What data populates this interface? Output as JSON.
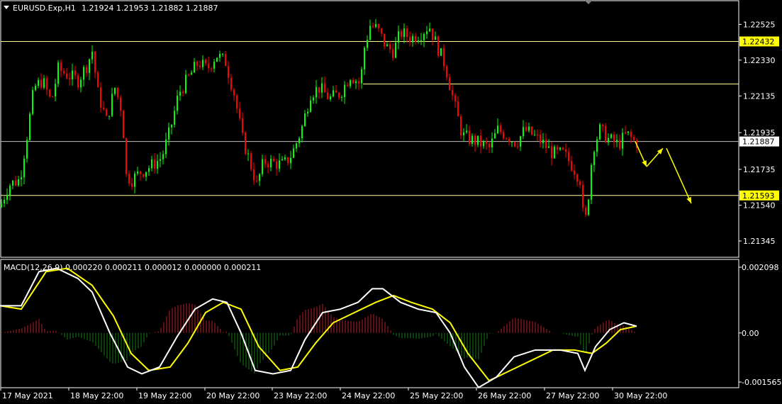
{
  "header": {
    "symbol": "EURUSD.Exp,H1",
    "ohlc": "1.21924 1.21953 1.21882 1.21887"
  },
  "macd_header": {
    "title": "MACD(12,26,9)",
    "values": "0.000220 0.000211 0.000012 0.000000 0.000211"
  },
  "price_axis": {
    "ticks": [
      "1.22525",
      "1.22330",
      "1.22135",
      "1.21935",
      "1.21735",
      "1.21540",
      "1.21345"
    ],
    "highlight_labels": [
      {
        "text": "1.22432",
        "color": "#ffff00"
      },
      {
        "text": "1.21887",
        "color": "#ffffff"
      },
      {
        "text": "1.21593",
        "color": "#ffff00"
      }
    ]
  },
  "macd_axis": {
    "ticks": [
      "0.002098",
      "0.00",
      "-0.001565"
    ]
  },
  "time_axis": {
    "labels": [
      "17 May 2021",
      "18 May 22:00",
      "19 May 22:00",
      "20 May 22:00",
      "23 May 22:00",
      "24 May 22:00",
      "25 May 22:00",
      "26 May 22:00",
      "27 May 22:00",
      "30 May 22:00"
    ]
  },
  "colors": {
    "background": "#000000",
    "bull": "#00ff00",
    "bear": "#ff0000",
    "level_line": "#ffff99",
    "signal": "#ffff00",
    "macd_line": "#ffffff",
    "hist_pos": "#b22222",
    "hist_neg": "#1a7a1a"
  },
  "chart_data": {
    "type": "candlestick",
    "symbol": "EURUSD",
    "timeframe": "H1",
    "ylim": [
      1.2126,
      1.2265
    ],
    "horizontal_levels": [
      1.22432,
      1.222,
      1.21887,
      1.21593
    ],
    "price_path": [
      [
        0,
        1.2153
      ],
      [
        12,
        1.2165
      ],
      [
        28,
        1.2168
      ],
      [
        38,
        1.2192
      ],
      [
        48,
        1.2218
      ],
      [
        60,
        1.2222
      ],
      [
        72,
        1.221
      ],
      [
        82,
        1.2228
      ],
      [
        95,
        1.2225
      ],
      [
        110,
        1.2222
      ],
      [
        122,
        1.223
      ],
      [
        130,
        1.2238
      ],
      [
        138,
        1.2215
      ],
      [
        150,
        1.22
      ],
      [
        162,
        1.2218
      ],
      [
        172,
        1.2205
      ],
      [
        178,
        1.217
      ],
      [
        186,
        1.2168
      ],
      [
        198,
        1.2172
      ],
      [
        212,
        1.2175
      ],
      [
        228,
        1.218
      ],
      [
        240,
        1.2195
      ],
      [
        252,
        1.2215
      ],
      [
        265,
        1.2223
      ],
      [
        280,
        1.2232
      ],
      [
        292,
        1.2228
      ],
      [
        305,
        1.2236
      ],
      [
        318,
        1.2232
      ],
      [
        330,
        1.2215
      ],
      [
        342,
        1.219
      ],
      [
        352,
        1.2178
      ],
      [
        362,
        1.2165
      ],
      [
        372,
        1.2178
      ],
      [
        386,
        1.2177
      ],
      [
        400,
        1.2176
      ],
      [
        412,
        1.2182
      ],
      [
        425,
        1.2195
      ],
      [
        438,
        1.2215
      ],
      [
        450,
        1.2218
      ],
      [
        465,
        1.2212
      ],
      [
        480,
        1.2215
      ],
      [
        494,
        1.2225
      ],
      [
        508,
        1.222
      ],
      [
        514,
        1.224
      ],
      [
        522,
        1.2252
      ],
      [
        532,
        1.225
      ],
      [
        545,
        1.224
      ],
      [
        555,
        1.2238
      ],
      [
        565,
        1.2248
      ],
      [
        580,
        1.2245
      ],
      [
        595,
        1.2248
      ],
      [
        605,
        1.2252
      ],
      [
        615,
        1.2242
      ],
      [
        628,
        1.223
      ],
      [
        640,
        1.221
      ],
      [
        652,
        1.2192
      ],
      [
        662,
        1.219
      ],
      [
        676,
        1.2188
      ],
      [
        690,
        1.2185
      ],
      [
        702,
        1.2195
      ],
      [
        715,
        1.2192
      ],
      [
        728,
        1.2188
      ],
      [
        740,
        1.2195
      ],
      [
        752,
        1.2192
      ],
      [
        765,
        1.2188
      ],
      [
        780,
        1.2182
      ],
      [
        795,
        1.2182
      ],
      [
        808,
        1.2175
      ],
      [
        818,
        1.2168
      ],
      [
        824,
        1.214
      ],
      [
        830,
        1.216
      ],
      [
        836,
        1.2185
      ],
      [
        846,
        1.2195
      ],
      [
        858,
        1.219
      ],
      [
        872,
        1.2187
      ],
      [
        884,
        1.2193
      ],
      [
        896,
        1.2188
      ]
    ],
    "forecast_arrows": [
      {
        "from": [
          896,
          1.21887
        ],
        "to": [
          912,
          1.2175
        ]
      },
      {
        "from": [
          912,
          1.2175
        ],
        "to": [
          935,
          1.2185
        ]
      },
      {
        "from": [
          940,
          1.2185
        ],
        "to": [
          975,
          1.2155
        ]
      }
    ],
    "macd": {
      "ylim": [
        -0.001565,
        0.002098
      ],
      "macd_line": [
        [
          0,
          0.0008
        ],
        [
          30,
          0.0008
        ],
        [
          55,
          0.0018
        ],
        [
          80,
          0.0019
        ],
        [
          110,
          0.0016
        ],
        [
          130,
          0.0012
        ],
        [
          155,
          0.0
        ],
        [
          180,
          -0.001
        ],
        [
          200,
          -0.0012
        ],
        [
          225,
          -0.001
        ],
        [
          250,
          -0.0001
        ],
        [
          275,
          0.0007
        ],
        [
          300,
          0.001
        ],
        [
          320,
          0.0009
        ],
        [
          340,
          0.0
        ],
        [
          360,
          -0.0011
        ],
        [
          385,
          -0.0012
        ],
        [
          410,
          -0.0011
        ],
        [
          430,
          -0.0002
        ],
        [
          455,
          0.0006
        ],
        [
          480,
          0.0007
        ],
        [
          505,
          0.0009
        ],
        [
          525,
          0.0013
        ],
        [
          540,
          0.0013
        ],
        [
          565,
          0.0009
        ],
        [
          590,
          0.0007
        ],
        [
          615,
          0.0006
        ],
        [
          635,
          0.0
        ],
        [
          655,
          -0.001
        ],
        [
          675,
          -0.0016
        ],
        [
          700,
          -0.0013
        ],
        [
          725,
          -0.0007
        ],
        [
          755,
          -0.0005
        ],
        [
          790,
          -0.0005
        ],
        [
          815,
          -0.0006
        ],
        [
          825,
          -0.0011
        ],
        [
          840,
          -0.0004
        ],
        [
          860,
          0.0001
        ],
        [
          880,
          0.0003
        ],
        [
          898,
          0.0002
        ]
      ],
      "signal_line": [
        [
          0,
          0.0008
        ],
        [
          30,
          0.0007
        ],
        [
          65,
          0.0018
        ],
        [
          95,
          0.0019
        ],
        [
          130,
          0.0014
        ],
        [
          160,
          0.0005
        ],
        [
          185,
          -0.0006
        ],
        [
          210,
          -0.0011
        ],
        [
          240,
          -0.001
        ],
        [
          265,
          -0.0003
        ],
        [
          290,
          0.0006
        ],
        [
          315,
          0.0009
        ],
        [
          340,
          0.0007
        ],
        [
          365,
          -0.0004
        ],
        [
          395,
          -0.0011
        ],
        [
          420,
          -0.001
        ],
        [
          445,
          -0.0003
        ],
        [
          470,
          0.0003
        ],
        [
          500,
          0.0006
        ],
        [
          530,
          0.0009
        ],
        [
          555,
          0.0011
        ],
        [
          580,
          0.0009
        ],
        [
          610,
          0.0007
        ],
        [
          635,
          0.0003
        ],
        [
          660,
          -0.0006
        ],
        [
          690,
          -0.0014
        ],
        [
          720,
          -0.0011
        ],
        [
          750,
          -0.0008
        ],
        [
          780,
          -0.0005
        ],
        [
          810,
          -0.0005
        ],
        [
          835,
          -0.0006
        ],
        [
          855,
          -0.0003
        ],
        [
          875,
          0.0001
        ],
        [
          898,
          0.0002
        ]
      ]
    }
  }
}
